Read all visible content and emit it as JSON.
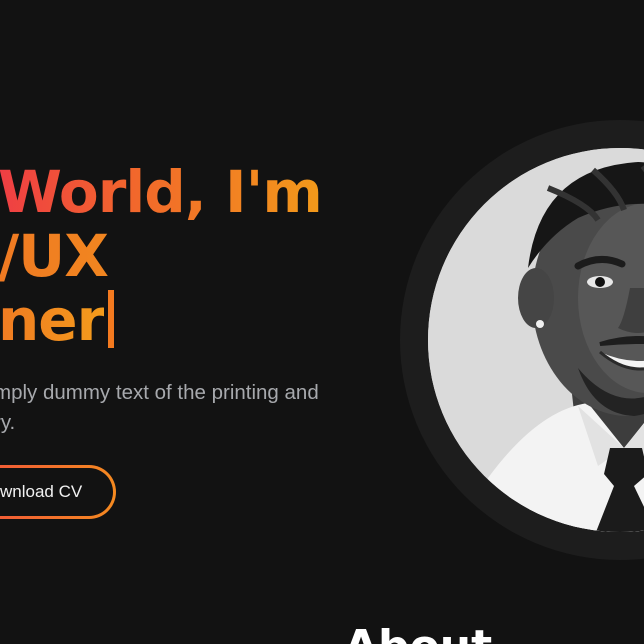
{
  "hero": {
    "headline_line1": "World, I'm",
    "headline_line2": "/UX",
    "headline_line3": "ner",
    "description_line1": "mply dummy text of the printing and",
    "description_line2": "ry.",
    "cv_button_label": "wnload CV"
  },
  "about": {
    "title": "About"
  },
  "colors": {
    "background": "#121212",
    "accent_red": "#ef3e44",
    "accent_orange": "#f58a20",
    "text_muted": "#a7a9ad",
    "avatar_ring": "#1d1d1d"
  }
}
